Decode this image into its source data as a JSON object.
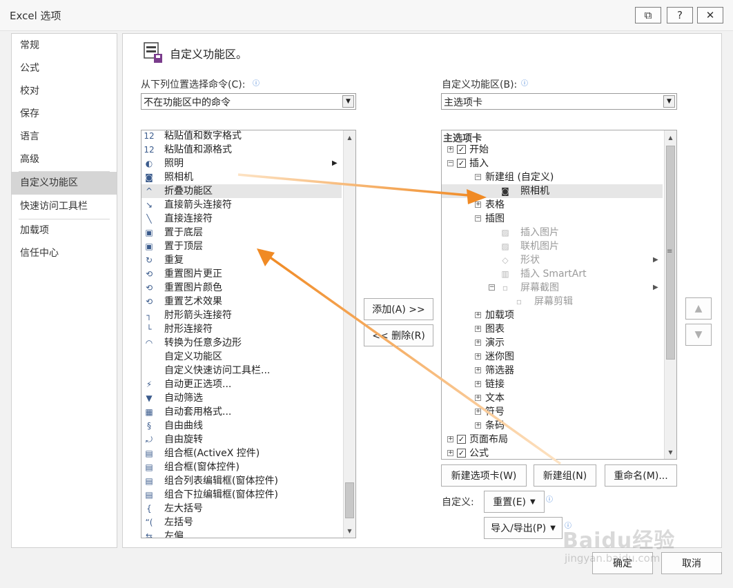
{
  "window": {
    "title": "Excel 选项",
    "restore_glyph": "⧉",
    "help_glyph": "?",
    "close_glyph": "✕"
  },
  "sidebar": {
    "items": [
      {
        "label": "常规"
      },
      {
        "label": "公式"
      },
      {
        "label": "校对"
      },
      {
        "label": "保存"
      },
      {
        "label": "语言"
      },
      {
        "label": "高级"
      },
      {
        "label": "自定义功能区",
        "selected": true
      },
      {
        "label": "快速访问工具栏"
      },
      {
        "label": "加载项"
      },
      {
        "label": "信任中心"
      }
    ]
  },
  "main": {
    "header": "自定义功能区。",
    "choose_label": "从下列位置选择命令(C):",
    "choose_value": "不在功能区中的命令",
    "customize_label": "自定义功能区(B):",
    "customize_value": "主选项卡",
    "commands": [
      {
        "icon": "paste-values-number-format-icon",
        "glyph": "12",
        "label": "粘贴值和数字格式"
      },
      {
        "icon": "paste-values-source-format-icon",
        "glyph": "12",
        "label": "粘贴值和源格式"
      },
      {
        "icon": "lighting-icon",
        "glyph": "◐",
        "label": "照明",
        "submenu": true
      },
      {
        "icon": "camera-icon",
        "glyph": "◙",
        "label": "照相机"
      },
      {
        "icon": "collapse-ribbon-icon",
        "glyph": "^",
        "label": "折叠功能区",
        "highlight": true
      },
      {
        "icon": "straight-arrow-connector-icon",
        "glyph": "↘",
        "label": "直接箭头连接符"
      },
      {
        "icon": "straight-connector-icon",
        "glyph": "╲",
        "label": "直接连接符"
      },
      {
        "icon": "send-to-back-icon",
        "glyph": "▣",
        "label": "置于底层"
      },
      {
        "icon": "bring-to-front-icon",
        "glyph": "▣",
        "label": "置于顶层"
      },
      {
        "icon": "redo-icon",
        "glyph": "↻",
        "label": "重复"
      },
      {
        "icon": "reset-picture-correction-icon",
        "glyph": "⟲",
        "label": "重置图片更正"
      },
      {
        "icon": "reset-picture-color-icon",
        "glyph": "⟲",
        "label": "重置图片颜色"
      },
      {
        "icon": "reset-art-effect-icon",
        "glyph": "⟲",
        "label": "重置艺术效果"
      },
      {
        "icon": "elbow-arrow-connector-icon",
        "glyph": "┐",
        "label": "肘形箭头连接符"
      },
      {
        "icon": "elbow-connector-icon",
        "glyph": "└",
        "label": "肘形连接符"
      },
      {
        "icon": "convert-to-freeform-icon",
        "glyph": "◠",
        "label": "转换为任意多边形"
      },
      {
        "icon": "",
        "glyph": "",
        "label": "自定义功能区"
      },
      {
        "icon": "",
        "glyph": "",
        "label": "自定义快速访问工具栏..."
      },
      {
        "icon": "autocorrect-options-icon",
        "glyph": "⚡",
        "label": "自动更正选项..."
      },
      {
        "icon": "autofilter-icon",
        "glyph": "▼",
        "label": "自动筛选"
      },
      {
        "icon": "autoformat-icon",
        "glyph": "▦",
        "label": "自动套用格式..."
      },
      {
        "icon": "freeform-curve-icon",
        "glyph": "§",
        "label": "自由曲线"
      },
      {
        "icon": "free-rotate-icon",
        "glyph": "⤾",
        "label": "自由旋转"
      },
      {
        "icon": "combo-box-activex-icon",
        "glyph": "▤",
        "label": "组合框(ActiveX 控件)"
      },
      {
        "icon": "combo-box-form-icon",
        "glyph": "▤",
        "label": "组合框(窗体控件)"
      },
      {
        "icon": "combo-list-edit-icon",
        "glyph": "▤",
        "label": "组合列表编辑框(窗体控件)"
      },
      {
        "icon": "combo-drop-down-icon",
        "glyph": "▤",
        "label": "组合下拉编辑框(窗体控件)"
      },
      {
        "icon": "left-brace-icon",
        "glyph": "{",
        "label": "左大括号"
      },
      {
        "icon": "left-bracket-icon",
        "glyph": "“(",
        "label": "左括号"
      },
      {
        "icon": "left-offset-icon",
        "glyph": "⇆",
        "label": "左偏"
      }
    ],
    "tree_header": "主选项卡",
    "tree": [
      {
        "level": 0,
        "expander": "+",
        "checkbox": true,
        "label": "开始"
      },
      {
        "level": 0,
        "expander": "−",
        "checkbox": true,
        "label": "插入"
      },
      {
        "level": 1,
        "expander": "−",
        "label": "新建组 (自定义)"
      },
      {
        "level": 2,
        "icon": "camera-icon",
        "glyph": "◙",
        "label": "照相机",
        "highlight": true
      },
      {
        "level": 1,
        "expander": "+",
        "label": "表格"
      },
      {
        "level": 1,
        "expander": "−",
        "label": "插图"
      },
      {
        "level": 2,
        "icon": "insert-picture-icon",
        "glyph": "▨",
        "label": "插入图片",
        "gray": true
      },
      {
        "level": 2,
        "icon": "online-picture-icon",
        "glyph": "▨",
        "label": "联机图片",
        "gray": true
      },
      {
        "level": 2,
        "icon": "shapes-icon",
        "glyph": "◇",
        "label": "形状",
        "gray": true,
        "submenu": true
      },
      {
        "level": 2,
        "icon": "smartart-icon",
        "glyph": "▥",
        "label": "插入 SmartArt",
        "gray": true
      },
      {
        "level": 2,
        "expander": "−",
        "icon": "screenshot-icon",
        "glyph": "▫",
        "label": "屏幕截图",
        "gray": true,
        "submenu": true
      },
      {
        "level": 3,
        "icon": "screen-clipping-icon",
        "glyph": "▫",
        "label": "屏幕剪辑",
        "gray": true
      },
      {
        "level": 1,
        "expander": "+",
        "label": "加载项"
      },
      {
        "level": 1,
        "expander": "+",
        "label": "图表"
      },
      {
        "level": 1,
        "expander": "+",
        "label": "演示"
      },
      {
        "level": 1,
        "expander": "+",
        "label": "迷你图"
      },
      {
        "level": 1,
        "expander": "+",
        "label": "筛选器"
      },
      {
        "level": 1,
        "expander": "+",
        "label": "链接"
      },
      {
        "level": 1,
        "expander": "+",
        "label": "文本"
      },
      {
        "level": 1,
        "expander": "+",
        "label": "符号"
      },
      {
        "level": 1,
        "expander": "+",
        "label": "条码"
      },
      {
        "level": 0,
        "expander": "+",
        "checkbox": true,
        "label": "页面布局"
      },
      {
        "level": 0,
        "expander": "+",
        "checkbox": true,
        "label": "公式"
      }
    ],
    "add_button": "添加(A) >>",
    "remove_button": "<< 删除(R)",
    "new_tab_button": "新建选项卡(W)",
    "new_group_button": "新建组(N)",
    "rename_button": "重命名(M)...",
    "customize_text": "自定义:",
    "reset_button": "重置(E)",
    "import_export_button": "导入/导出(P)",
    "ok_button": "确定",
    "cancel_button": "取消",
    "watermark_brand": "Baidu经验",
    "watermark_url": "jingyan.baidu.com"
  },
  "colors": {
    "annotation_arrow": "#f08a24",
    "selected_nav": "#d5d5d5"
  }
}
